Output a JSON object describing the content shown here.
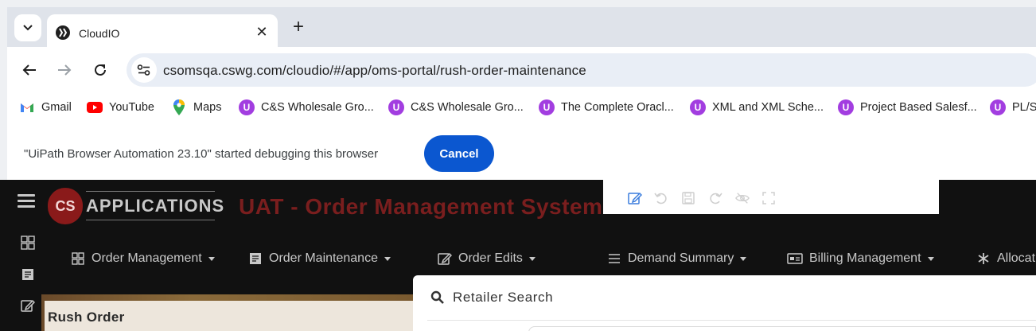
{
  "browser": {
    "tab": {
      "title": "CloudIO"
    },
    "address": {
      "url": "csomsqa.cswg.com/cloudio/#/app/oms-portal/rush-order-maintenance"
    },
    "bookmarks": [
      {
        "label": "Gmail",
        "icon": "gmail-icon"
      },
      {
        "label": "YouTube",
        "icon": "youtube-icon"
      },
      {
        "label": "Maps",
        "icon": "maps-icon"
      },
      {
        "label": "C&S Wholesale Gro...",
        "icon": "uipath-icon"
      },
      {
        "label": "C&S Wholesale Gro...",
        "icon": "uipath-icon"
      },
      {
        "label": "The Complete Oracl...",
        "icon": "uipath-icon"
      },
      {
        "label": "XML and XML Sche...",
        "icon": "uipath-icon"
      },
      {
        "label": "Project Based Salesf...",
        "icon": "uipath-icon"
      },
      {
        "label": "PL/S",
        "icon": "uipath-icon"
      }
    ],
    "infobar": {
      "message": "\"UiPath Browser Automation 23.10\" started debugging this browser",
      "cancel_label": "Cancel"
    }
  },
  "app": {
    "logo_text": "APPLICATIONS",
    "title": "UAT - Order Management System",
    "menus": [
      {
        "label": "Order Management",
        "icon": "grid-icon"
      },
      {
        "label": "Order Maintenance",
        "icon": "list-box-icon"
      },
      {
        "label": "Order Edits",
        "icon": "edit-icon"
      },
      {
        "label": "Demand Summary",
        "icon": "bars-icon"
      },
      {
        "label": "Billing Management",
        "icon": "billing-icon"
      },
      {
        "label": "Allocati",
        "icon": "asterisk-icon"
      }
    ],
    "rush_order_title": "Rush Order",
    "retailer_search_title": "Retailer Search"
  },
  "colors": {
    "accent_blue": "#0b57d0",
    "app_title_red": "#7a1e1e",
    "uipath_purple": "#a23de0"
  }
}
